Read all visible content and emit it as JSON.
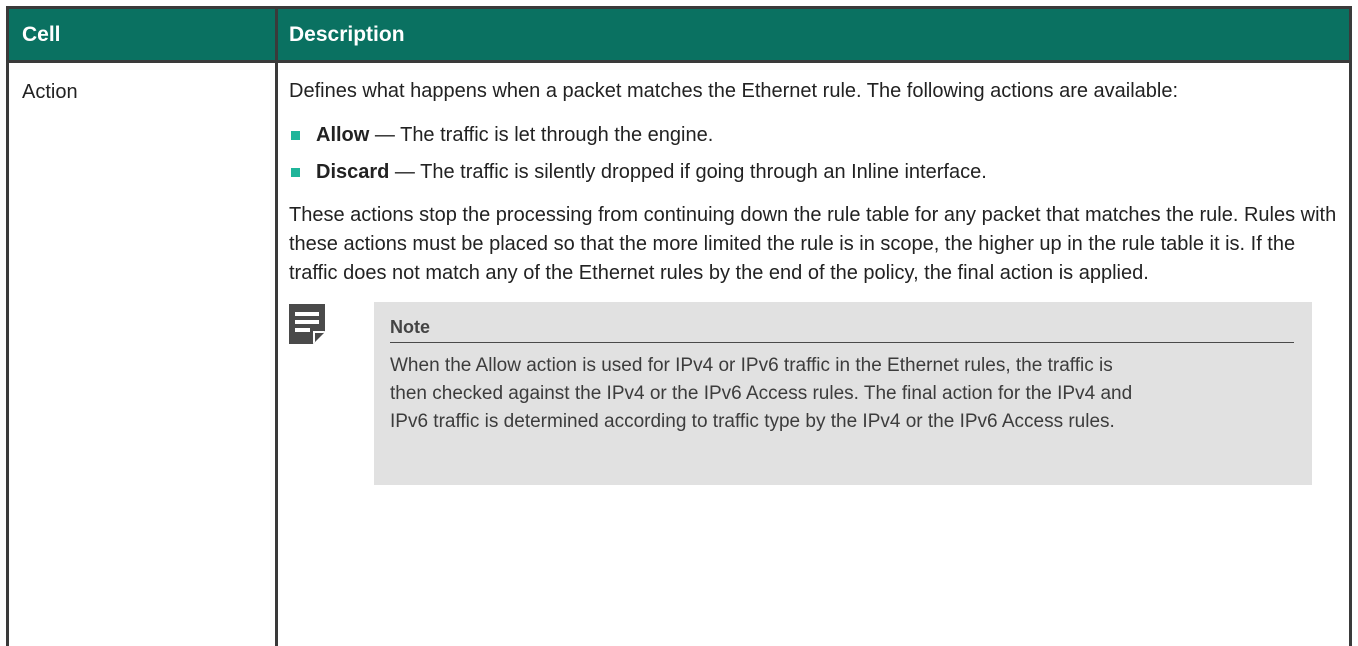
{
  "table": {
    "headers": {
      "cell": "Cell",
      "description": "Description"
    },
    "rows": [
      {
        "cell": "Action",
        "intro": "Defines what happens when a packet matches the Ethernet rule. The following actions are available:",
        "bullets": [
          {
            "term": "Allow",
            "text": " — The traffic is let through the engine."
          },
          {
            "term": "Discard",
            "text": " — The traffic is silently dropped if going through an Inline interface."
          }
        ],
        "paragraph": "These actions stop the processing from continuing down the rule table for any packet that matches the rule. Rules with these actions must be placed so that the more limited the rule is in scope, the higher up in the rule table it is. If the traffic does not match any of the Ethernet rules by the end of the policy, the final action is applied.",
        "note": {
          "icon": "note-icon",
          "title": "Note",
          "body": "When the Allow action is used for IPv4 or IPv6 traffic in the Ethernet rules, the traffic is then checked against the IPv4 or the IPv6 Access rules. The final action for the IPv4 and IPv6 traffic is determined according to traffic type by the IPv4 or the IPv6 Access rules."
        }
      }
    ]
  },
  "colors": {
    "header_bg": "#0a7161",
    "header_text": "#ffffff",
    "bullet": "#1fb59a",
    "note_bg": "#e1e1e1",
    "border": "#3a3a3a"
  }
}
